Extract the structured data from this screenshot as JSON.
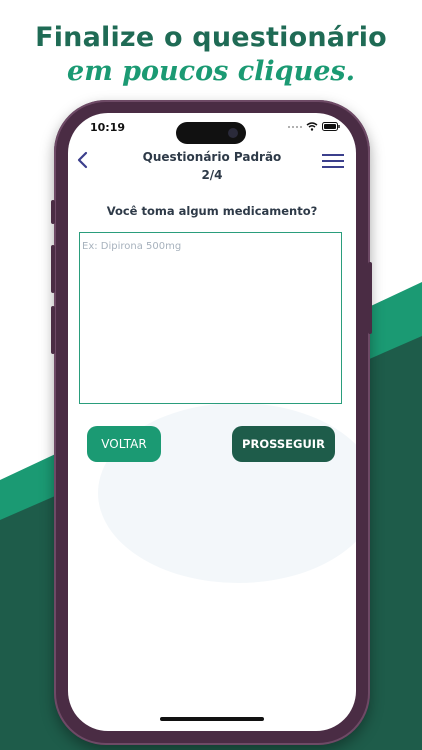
{
  "banner": {
    "line1": "Finalize o questionário",
    "line2": "em poucos cliques."
  },
  "status_bar": {
    "time": "10:19"
  },
  "header": {
    "title": "Questionário Padrão",
    "step": "2/4"
  },
  "question": {
    "text": "Você toma algum medicamento?",
    "placeholder": "Ex: Dipirona 500mg",
    "value": ""
  },
  "buttons": {
    "back_label": "VOLTAR",
    "next_label": "PROSSEGUIR"
  },
  "colors": {
    "brand_green": "#1b9a73",
    "dark_green": "#1e5c4a",
    "phone_frame": "#4a2c44",
    "menu_icon": "#3b3f8c"
  },
  "icons": [
    "back-chevron-icon",
    "menu-icon",
    "wifi-icon",
    "battery-icon"
  ]
}
